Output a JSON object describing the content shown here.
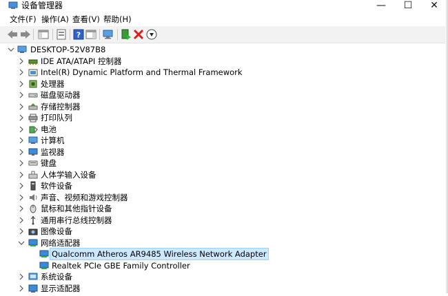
{
  "window": {
    "title": "设备管理器",
    "controls": {
      "minimize": "—",
      "maximize": "☐",
      "close": "✕"
    }
  },
  "menu": [
    "文件(F)",
    "操作(A)",
    "查看(V)",
    "帮助(H)"
  ],
  "tree": {
    "root": "DESKTOP-52V87B8",
    "categories": [
      {
        "label": "IDE ATA/ATAPI 控制器",
        "icon": "ide-controller-icon"
      },
      {
        "label": "Intel(R) Dynamic Platform and Thermal Framework",
        "icon": "thermal-framework-icon"
      },
      {
        "label": "处理器",
        "icon": "processor-icon"
      },
      {
        "label": "磁盘驱动器",
        "icon": "disk-drive-icon"
      },
      {
        "label": "存储控制器",
        "icon": "storage-controller-icon"
      },
      {
        "label": "打印队列",
        "icon": "printer-icon"
      },
      {
        "label": "电池",
        "icon": "battery-icon"
      },
      {
        "label": "计算机",
        "icon": "computer-icon"
      },
      {
        "label": "监视器",
        "icon": "monitor-icon"
      },
      {
        "label": "键盘",
        "icon": "keyboard-icon"
      },
      {
        "label": "人体学输入设备",
        "icon": "hid-icon"
      },
      {
        "label": "软件设备",
        "icon": "software-device-icon"
      },
      {
        "label": "声音、视频和游戏控制器",
        "icon": "sound-icon"
      },
      {
        "label": "鼠标和其他指针设备",
        "icon": "mouse-icon"
      },
      {
        "label": "通用串行总线控制器",
        "icon": "usb-icon"
      },
      {
        "label": "图像设备",
        "icon": "camera-icon"
      },
      {
        "label": "网络适配器",
        "icon": "network-adapter-icon",
        "expanded": true,
        "children": [
          {
            "label": "Qualcomm Atheros AR9485 Wireless Network Adapter",
            "selected": true
          },
          {
            "label": "Realtek PCIe GBE Family Controller"
          }
        ]
      },
      {
        "label": "系统设备",
        "icon": "system-device-icon"
      },
      {
        "label": "显示适配器",
        "icon": "display-adapter-icon"
      }
    ]
  }
}
